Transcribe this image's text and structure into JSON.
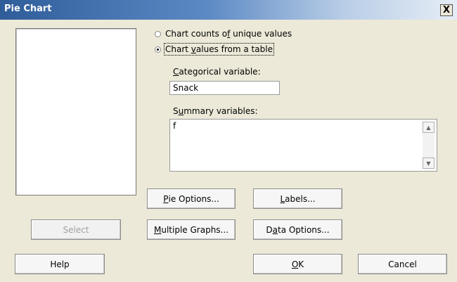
{
  "window": {
    "title": "Pie Chart",
    "close_label": "X"
  },
  "options": {
    "radio_unique": {
      "label": "Chart counts of unique values",
      "checked": false
    },
    "radio_table": {
      "label": "Chart values from a table",
      "checked": true
    }
  },
  "categorical": {
    "label": "Categorical variable:",
    "value": "Snack"
  },
  "summary": {
    "label": "Summary variables:",
    "value": "f"
  },
  "buttons": {
    "pie_options": "Pie Options...",
    "labels": "Labels...",
    "select": "Select",
    "multiple_graphs": "Multiple Graphs...",
    "data_options": "Data Options...",
    "help": "Help",
    "ok": "OK",
    "cancel": "Cancel"
  }
}
